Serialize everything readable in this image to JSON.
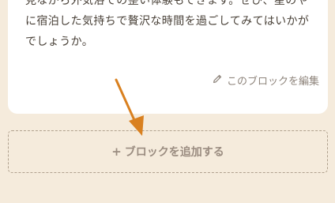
{
  "content": {
    "lines": [
      "見ながら外気浴での整い体験もできます。ぜひ、星のや",
      "に宿泊した気持ちで贅沢な時間を過ごしてみてはいかが",
      "でしょうか。"
    ]
  },
  "edit_block": {
    "icon": "pencil-icon",
    "label": "このブロックを編集"
  },
  "add_block": {
    "icon": "plus-icon",
    "plus": "+",
    "label": "ブロックを追加する"
  },
  "colors": {
    "background": "#f5ebdc",
    "card": "#ffffff",
    "arrow": "#d9801f",
    "muted_text": "#8e847b"
  }
}
